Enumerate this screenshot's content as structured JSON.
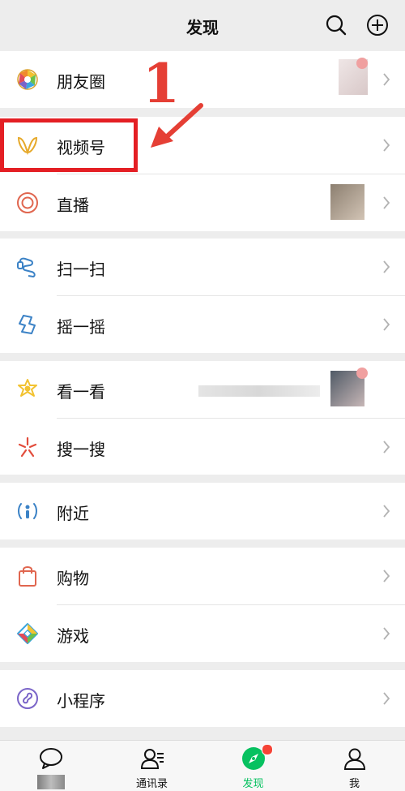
{
  "header": {
    "title": "发现"
  },
  "sections": [
    {
      "items": [
        {
          "label": "朋友圈"
        }
      ]
    },
    {
      "items": [
        {
          "label": "视频号"
        },
        {
          "label": "直播"
        }
      ]
    },
    {
      "items": [
        {
          "label": "扫一扫"
        },
        {
          "label": "摇一摇"
        }
      ]
    },
    {
      "items": [
        {
          "label": "看一看"
        },
        {
          "label": "搜一搜"
        }
      ]
    },
    {
      "items": [
        {
          "label": "附近"
        }
      ]
    },
    {
      "items": [
        {
          "label": "购物"
        },
        {
          "label": "游戏"
        }
      ]
    },
    {
      "items": [
        {
          "label": "小程序"
        }
      ]
    }
  ],
  "annotation": {
    "number": "1"
  },
  "tabbar": {
    "tabs": [
      {
        "label": ""
      },
      {
        "label": "通讯录"
      },
      {
        "label": "发现"
      },
      {
        "label": "我"
      }
    ]
  },
  "colors": {
    "accent": "#07c160",
    "annotation_red": "#e53f35",
    "background": "#ededed"
  }
}
